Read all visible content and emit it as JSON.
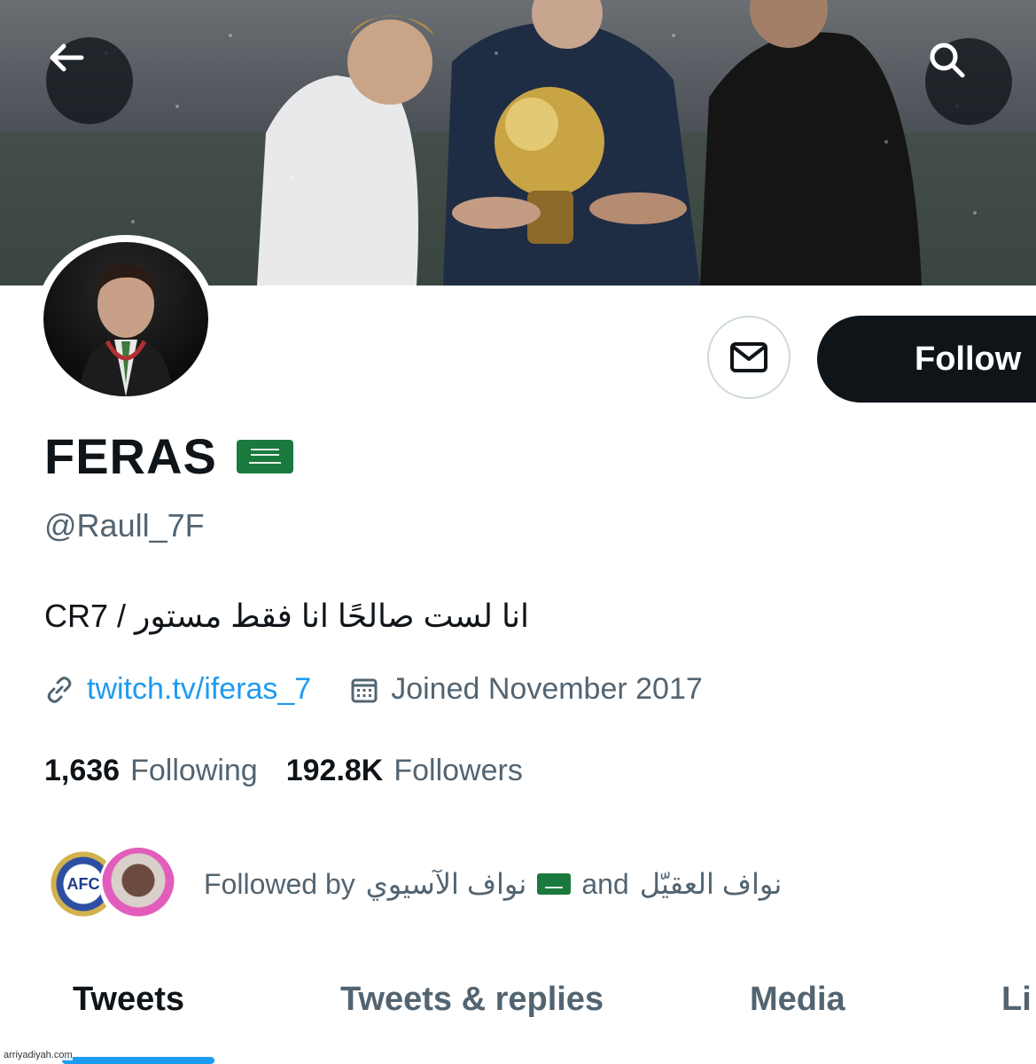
{
  "profile": {
    "display_name": "FERAS",
    "handle": "@Raull_7F",
    "bio": "انا لست صالحًا انا فقط مستور / CR7",
    "link": "twitch.tv/iferas_7",
    "joined": "Joined November 2017"
  },
  "actions": {
    "follow_label": "Follow"
  },
  "stats": {
    "following_count": "1,636",
    "following_label": "Following",
    "followers_count": "192.8K",
    "followers_label": "Followers"
  },
  "followed_by": {
    "prefix": "Followed by",
    "first": "نواف الآسيوي",
    "connector": "and",
    "second": "نواف العقيّل",
    "afc_logo_text": "AFC"
  },
  "tabs": [
    {
      "label": "Tweets",
      "active": true
    },
    {
      "label": "Tweets & replies",
      "active": false
    },
    {
      "label": "Media",
      "active": false
    },
    {
      "label": "Li",
      "active": false
    }
  ],
  "watermark": "arriyadiyah.com",
  "colors": {
    "accent": "#1d9bf0",
    "text_primary": "#0f1419",
    "text_secondary": "#536471",
    "follow_button_bg": "#0f1419",
    "flag_green": "#1a7a3e"
  },
  "icons": {
    "back": "arrow-left-icon",
    "search": "search-icon",
    "message": "envelope-icon",
    "link": "link-icon",
    "calendar": "calendar-icon",
    "flag": "saudi-flag-icon"
  }
}
